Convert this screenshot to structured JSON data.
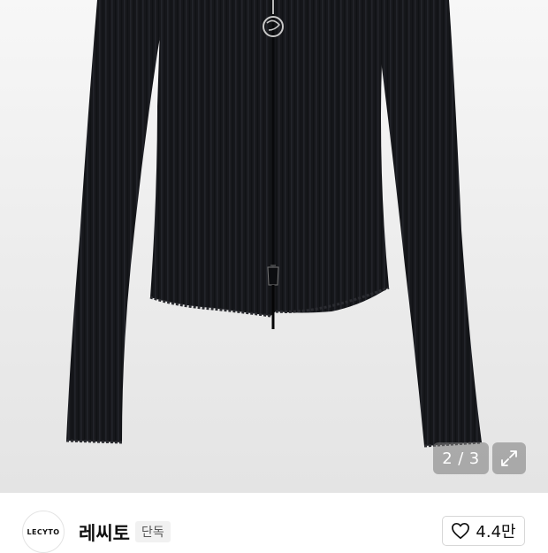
{
  "gallery": {
    "current_page": "2",
    "separator": "/",
    "total_pages": "3",
    "expand_icon": "expand-arrows-icon"
  },
  "brand": {
    "logo_text": "LECYTO",
    "name": "레씨토",
    "badge": "단독"
  },
  "like": {
    "icon": "heart-outline-icon",
    "count": "4.4만"
  },
  "colors": {
    "garment": "#17181c",
    "background": "#ececec",
    "indicator_bg": "#8a8a8a"
  }
}
